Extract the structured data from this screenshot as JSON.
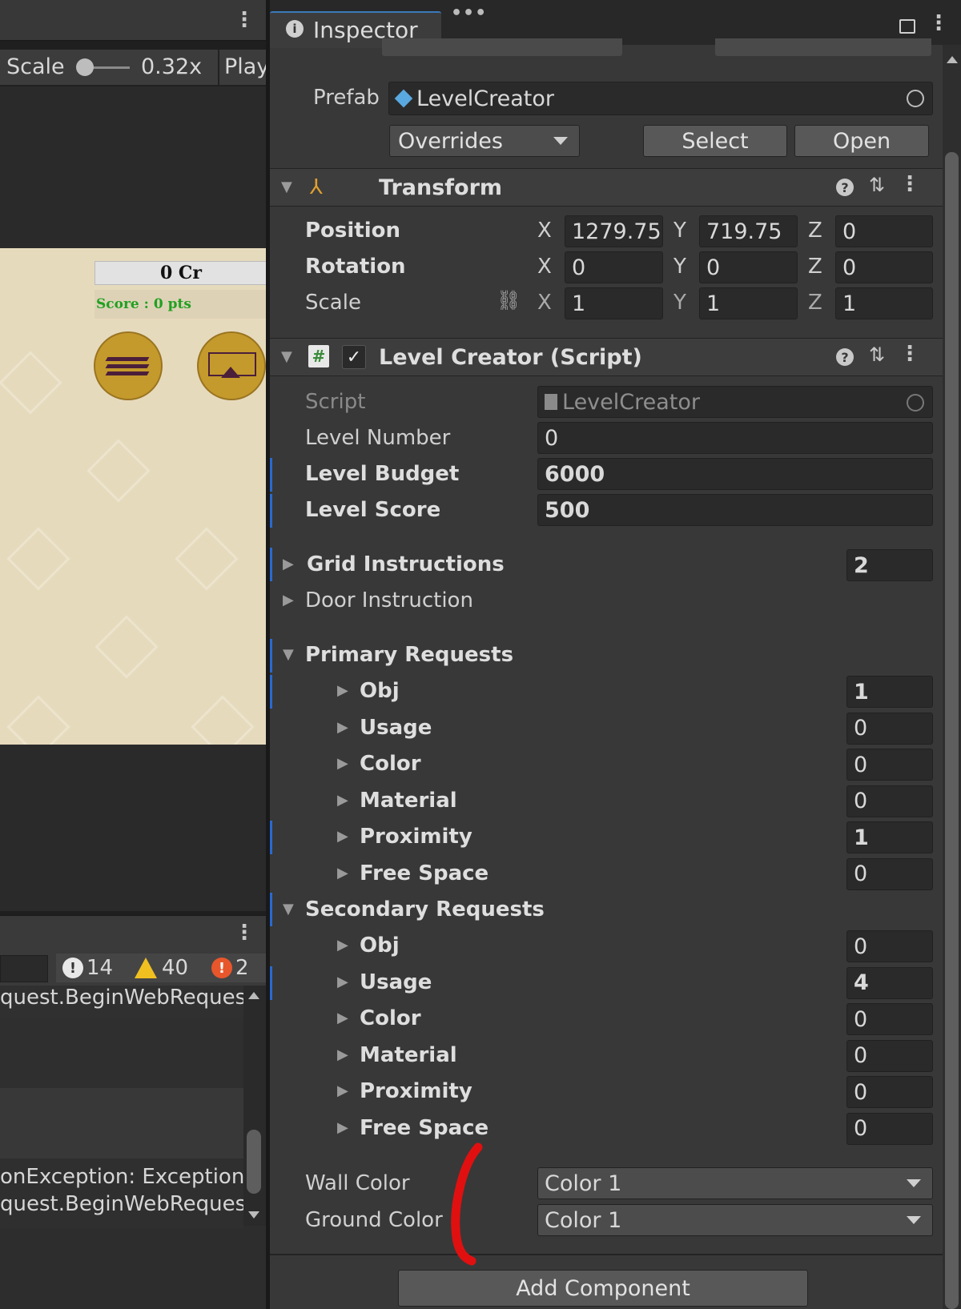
{
  "left": {
    "game_toolbar": {
      "scale_label": "Scale",
      "scale_value": "0.32x",
      "play_label": "Play"
    },
    "game": {
      "credits": "0 Cr",
      "score": "Score : 0 pts"
    },
    "console": {
      "badge_info": "14",
      "badge_warn": "40",
      "badge_error": "2",
      "lines": [
        "quest.BeginWebReques",
        "onException: Exception",
        "quest.BeginWebReques"
      ]
    }
  },
  "inspector": {
    "tab_label": "Inspector",
    "prefab": {
      "label": "Prefab",
      "value": "LevelCreator",
      "overrides": "Overrides",
      "select": "Select",
      "open": "Open"
    },
    "transform": {
      "title": "Transform",
      "position": {
        "label": "Position",
        "x": "1279.75",
        "y": "719.75",
        "z": "0"
      },
      "rotation": {
        "label": "Rotation",
        "x": "0",
        "y": "0",
        "z": "0"
      },
      "scale": {
        "label": "Scale",
        "x": "1",
        "y": "1",
        "z": "1"
      },
      "axis_x": "X",
      "axis_y": "Y",
      "axis_z": "Z"
    },
    "script": {
      "title": "Level Creator (Script)",
      "script_label": "Script",
      "script_value": "LevelCreator",
      "level_number_label": "Level Number",
      "level_number": "0",
      "level_budget_label": "Level Budget",
      "level_budget": "6000",
      "level_score_label": "Level Score",
      "level_score": "500",
      "grid_instructions_label": "Grid Instructions",
      "grid_instructions": "2",
      "door_instruction_label": "Door Instruction",
      "primary_label": "Primary Requests",
      "primary": [
        {
          "label": "Obj",
          "value": "1"
        },
        {
          "label": "Usage",
          "value": "0"
        },
        {
          "label": "Color",
          "value": "0"
        },
        {
          "label": "Material",
          "value": "0"
        },
        {
          "label": "Proximity",
          "value": "1"
        },
        {
          "label": "Free Space",
          "value": "0"
        }
      ],
      "secondary_label": "Secondary Requests",
      "secondary": [
        {
          "label": "Obj",
          "value": "0"
        },
        {
          "label": "Usage",
          "value": "4"
        },
        {
          "label": "Color",
          "value": "0"
        },
        {
          "label": "Material",
          "value": "0"
        },
        {
          "label": "Proximity",
          "value": "0"
        },
        {
          "label": "Free Space",
          "value": "0"
        }
      ],
      "wall_color_label": "Wall Color",
      "wall_color": "Color 1",
      "ground_color_label": "Ground Color",
      "ground_color": "Color 1"
    },
    "add_component": "Add Component"
  },
  "colors": {
    "accent_blue": "#3a79bb",
    "override_bar": "#2a6ad0",
    "annotation_red": "#e01010",
    "game_bg": "#e6dabd",
    "coin_gold": "#c49a2c"
  }
}
